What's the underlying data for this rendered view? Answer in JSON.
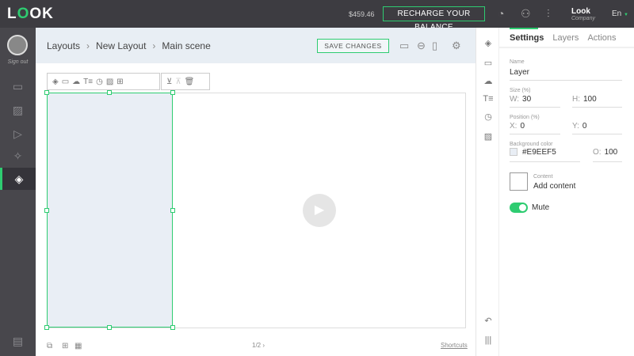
{
  "topbar": {
    "logo": "LOOK",
    "balance": "$459.46",
    "recharge_label": "RECHARGE YOUR BALANCE",
    "user_name": "Look",
    "user_sub": "Company",
    "language": "En"
  },
  "sidebar": {
    "signout": "Sign out"
  },
  "header": {
    "breadcrumb": [
      "Layouts",
      "New Layout",
      "Main scene"
    ],
    "save_label": "SAVE CHANGES"
  },
  "footer": {
    "page": "1/2",
    "shortcuts": "Shortcuts"
  },
  "panel": {
    "tabs": [
      "Settings",
      "Layers",
      "Actions"
    ],
    "name_label": "Name",
    "name_value": "Layer",
    "size_label": "Size (%)",
    "w_label": "W:",
    "w": "30",
    "h_label": "H:",
    "h": "100",
    "pos_label": "Position (%)",
    "x_label": "X:",
    "x": "0",
    "y_label": "Y:",
    "y": "0",
    "bg_label": "Background color",
    "bg_value": "#E9EEF5",
    "o_label": "O:",
    "opacity": "100",
    "content_label": "Content",
    "content_value": "Add content",
    "mute_label": "Mute",
    "mute_on": true
  },
  "colors": {
    "accent": "#2ecc71",
    "topbar": "#3d3c41",
    "layer_fill": "#E9EEF5"
  }
}
